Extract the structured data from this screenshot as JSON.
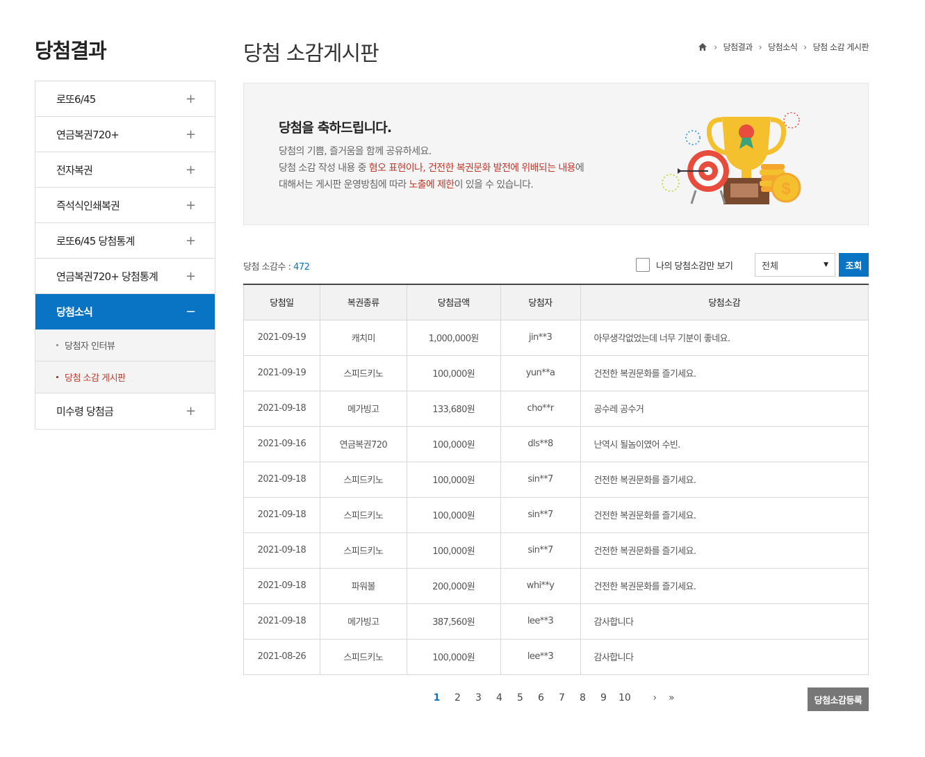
{
  "sidebar": {
    "title": "당첨결과",
    "items": [
      {
        "label": "로또6/45",
        "icon": "+"
      },
      {
        "label": "연금복권720+",
        "icon": "+"
      },
      {
        "label": "전자복권",
        "icon": "+"
      },
      {
        "label": "즉석식인쇄복권",
        "icon": "+"
      },
      {
        "label": "로또6/45 당첨통계",
        "icon": "+"
      },
      {
        "label": "연금복권720+ 당첨통계",
        "icon": "+"
      },
      {
        "label": "당첨소식",
        "icon": "−"
      },
      {
        "label": "미수령 당첨금",
        "icon": "+"
      }
    ],
    "sub_items": [
      {
        "label": "당첨자 인터뷰"
      },
      {
        "label": "당첨 소감 게시판"
      }
    ]
  },
  "header": {
    "title": "당첨 소감게시판",
    "breadcrumb": [
      "당첨결과",
      "당첨소식",
      "당첨 소감 게시판"
    ]
  },
  "banner": {
    "heading": "당첨을 축하드립니다.",
    "line1": "당첨의 기쁨, 즐거움을 함께 공유하세요.",
    "line2_a": "당첨 소감 작성 내용 중 ",
    "line2_b": "혐오 표현이나, 건전한 복권문화 발전에 위배되는 내용",
    "line2_c": "에",
    "line3_a": "대해서는 게시판 운영방침에 따라 ",
    "line3_b": "노출에 제한",
    "line3_c": "이 있을 수 있습니다."
  },
  "toolbar": {
    "count_label": "당첨 소감수 : ",
    "count_value": "472",
    "mine_label": "나의 당첨소감만 보기",
    "filter_value": "전체",
    "search_label": "조회"
  },
  "table": {
    "headers": [
      "당첨일",
      "복권종류",
      "당첨금액",
      "당첨자",
      "당첨소감"
    ],
    "rows": [
      [
        "2021-09-19",
        "캐치미",
        "1,000,000원",
        "jin**3",
        "아무생각없었는데 너무 기분이 좋네요."
      ],
      [
        "2021-09-19",
        "스피드키노",
        "100,000원",
        "yun**a",
        "건전한 복권문화를 즐기세요."
      ],
      [
        "2021-09-18",
        "메가빙고",
        "133,680원",
        "cho**r",
        "공수레 공수거"
      ],
      [
        "2021-09-16",
        "연금복권720",
        "100,000원",
        "dls**8",
        "난역시 될놈이였어 수빈."
      ],
      [
        "2021-09-18",
        "스피드키노",
        "100,000원",
        "sin**7",
        "건전한 복권문화를 즐기세요."
      ],
      [
        "2021-09-18",
        "스피드키노",
        "100,000원",
        "sin**7",
        "건전한 복권문화를 즐기세요."
      ],
      [
        "2021-09-18",
        "스피드키노",
        "100,000원",
        "sin**7",
        "건전한 복권문화를 즐기세요."
      ],
      [
        "2021-09-18",
        "파워볼",
        "200,000원",
        "whi**y",
        "건전한 복권문화를 즐기세요."
      ],
      [
        "2021-09-18",
        "메가빙고",
        "387,560원",
        "lee**3",
        "감사합니다"
      ],
      [
        "2021-08-26",
        "스피드키노",
        "100,000원",
        "lee**3",
        "감사합니다"
      ]
    ]
  },
  "pagination": {
    "pages": [
      "1",
      "2",
      "3",
      "4",
      "5",
      "6",
      "7",
      "8",
      "9",
      "10"
    ],
    "current": "1",
    "next": "›",
    "last": "»"
  },
  "register_label": "당첨소감등록",
  "colors": {
    "accent": "#0a74c4",
    "highlight": "#c0392b",
    "button_gray": "#777777"
  }
}
